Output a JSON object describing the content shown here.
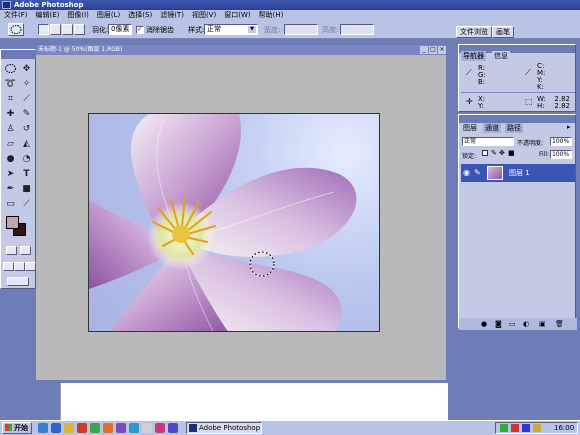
{
  "window": {
    "title": "Adobe Photoshop"
  },
  "menu": [
    "文件(F)",
    "编辑(E)",
    "图像(I)",
    "图层(L)",
    "选择(S)",
    "滤镜(T)",
    "视图(V)",
    "窗口(W)",
    "帮助(H)"
  ],
  "options": {
    "feather_label": "羽化:",
    "feather_value": "0像素",
    "antialias_label": "消除锯齿",
    "style_label": "样式:",
    "style_value": "正常",
    "width_label": "宽度:",
    "height_label": "高度:"
  },
  "palette_well": {
    "tabs": [
      "文件浏览",
      "画笔"
    ]
  },
  "document": {
    "title": "未标题-1 @ 50%(图层 1,RGB)"
  },
  "navigator": {
    "tabs": [
      "导航器",
      "信息"
    ],
    "rgb_labels": [
      "R:",
      "G:",
      "B:"
    ],
    "cmyk_labels": [
      "C:",
      "M:",
      "Y:",
      "K:"
    ],
    "xy_labels": [
      "X:",
      "Y:"
    ],
    "wh_labels": [
      "W:",
      "H:"
    ],
    "w_value": "2.82",
    "h_value": "2.82"
  },
  "layers": {
    "tabs": [
      "图层",
      "通道",
      "路径"
    ],
    "blend_mode": "正常",
    "opacity_label": "不透明度:",
    "opacity_value": "100%",
    "lock_label": "锁定:",
    "fill_label": "Fill:",
    "fill_value": "100%",
    "layer_name": "图层 1"
  },
  "taskbar": {
    "start_label": "开始",
    "task_label": "Adobe Photoshop",
    "clock": "16:00"
  },
  "colors": {
    "foreground": "#c2a5ad",
    "background": "#2b1618",
    "title_bar": "#2f46a0",
    "panel": "#c4cae6"
  }
}
